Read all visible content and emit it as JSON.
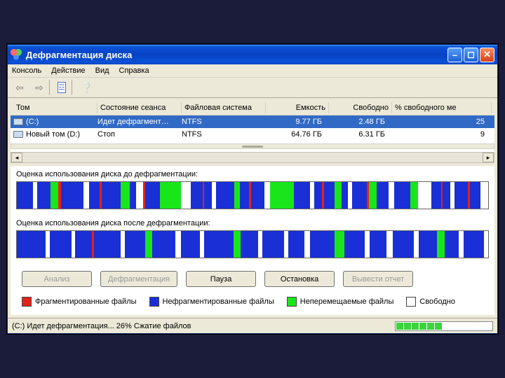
{
  "window": {
    "title": "Дефрагментация диска"
  },
  "menu": {
    "console": "Консоль",
    "action": "Действие",
    "view": "Вид",
    "help": "Справка"
  },
  "columns": {
    "volume": "Том",
    "session_state": "Состояние сеанса",
    "filesystem": "Файловая система",
    "capacity": "Емкость",
    "free": "Свободно",
    "pct_free": "% свободного ме"
  },
  "volumes": [
    {
      "name": "(C:)",
      "state": "Идет дефрагмент…",
      "fs": "NTFS",
      "capacity": "9.77 ГБ",
      "free": "2.48 ГБ",
      "pct": "25",
      "selected": true
    },
    {
      "name": "Новый том (D:)",
      "state": "Стоп",
      "fs": "NTFS",
      "capacity": "64.76 ГБ",
      "free": "6.31 ГБ",
      "pct": "9",
      "selected": false
    }
  ],
  "labels": {
    "before": "Оценка использования диска до дефрагментации:",
    "after": "Оценка использования диска после дефрагментации:"
  },
  "buttons": {
    "analyze": "Анализ",
    "defrag": "Дефрагментация",
    "pause": "Пауза",
    "stop": "Остановка",
    "report": "Вывести отчет"
  },
  "legend": {
    "fragmented": "Фрагментированные файлы",
    "contiguous": "Нефрагментированные файлы",
    "unmovable": "Неперемещаемые файлы",
    "free": "Свободно"
  },
  "status": {
    "text": "(C:) Идет дефрагментация... 26%  Сжатие файлов",
    "progress_segments_on": 6,
    "progress_segments_total": 12
  },
  "colors": {
    "red": "#e2231a",
    "blue": "#1a2fd6",
    "green": "#19e619",
    "white": "#ffffff"
  },
  "chart_data": {
    "type": "bar",
    "title": "Disk usage map (segment widths, arbitrary units)",
    "series": [
      {
        "name": "before",
        "colors": [
          "blue",
          "white",
          "blue",
          "green",
          "red",
          "blue",
          "white",
          "blue",
          "red",
          "blue",
          "green",
          "blue",
          "white",
          "red",
          "blue",
          "green",
          "white",
          "blue",
          "red",
          "blue",
          "white",
          "blue",
          "green",
          "blue",
          "red",
          "blue",
          "white",
          "green",
          "blue",
          "white",
          "blue",
          "red",
          "blue",
          "green",
          "blue",
          "white",
          "blue",
          "red",
          "green",
          "blue",
          "white",
          "blue",
          "green",
          "white",
          "blue",
          "red",
          "blue",
          "white",
          "blue",
          "red",
          "blue",
          "white"
        ],
        "widths": [
          22,
          6,
          18,
          10,
          4,
          30,
          8,
          14,
          3,
          26,
          12,
          8,
          10,
          3,
          20,
          28,
          14,
          16,
          2,
          10,
          6,
          24,
          8,
          12,
          3,
          18,
          8,
          32,
          22,
          6,
          10,
          3,
          14,
          10,
          8,
          6,
          20,
          3,
          10,
          16,
          8,
          22,
          10,
          18,
          14,
          2,
          10,
          6,
          18,
          3,
          14,
          10
        ]
      },
      {
        "name": "after",
        "colors": [
          "blue",
          "white",
          "blue",
          "white",
          "blue",
          "red",
          "blue",
          "white",
          "blue",
          "green",
          "blue",
          "white",
          "blue",
          "white",
          "blue",
          "green",
          "blue",
          "white",
          "blue",
          "white",
          "blue",
          "white",
          "blue",
          "green",
          "blue",
          "white",
          "blue",
          "white",
          "blue",
          "white",
          "blue",
          "green",
          "blue",
          "white",
          "blue",
          "white"
        ],
        "widths": [
          40,
          6,
          30,
          4,
          24,
          3,
          36,
          6,
          28,
          10,
          32,
          8,
          26,
          6,
          40,
          10,
          24,
          6,
          30,
          6,
          22,
          8,
          34,
          14,
          28,
          6,
          24,
          8,
          30,
          6,
          26,
          10,
          20,
          6,
          28,
          6
        ]
      }
    ]
  }
}
